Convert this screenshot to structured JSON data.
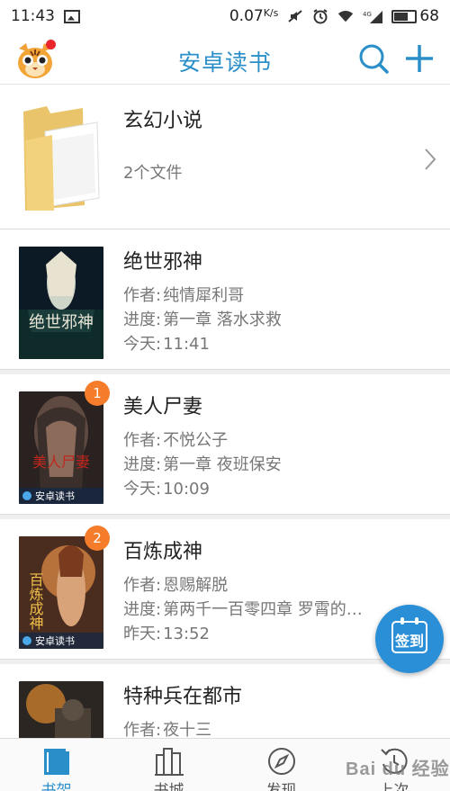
{
  "status_bar": {
    "time": "11:43",
    "speed": "0.07",
    "speed_unit": "K/s",
    "network": "4G",
    "battery": "68",
    "battery_level": 0.68
  },
  "header": {
    "title": "安卓读书",
    "search_icon": "search-icon",
    "add_icon": "plus-icon",
    "accent_color": "#2a8fc9"
  },
  "folder": {
    "title": "玄幻小说",
    "count": "2个文件"
  },
  "books": [
    {
      "title": "绝世邪神",
      "author_label": "作者:",
      "author": "纯情犀利哥",
      "progress_label": "进度:",
      "progress": "第一章 落水求救",
      "time_label": "今天:",
      "time": "11:41",
      "badge": "",
      "cover_text": "绝世邪神",
      "cover_brand": ""
    },
    {
      "title": "美人尸妻",
      "author_label": "作者:",
      "author": "不悦公子",
      "progress_label": "进度:",
      "progress": "第一章 夜班保安",
      "time_label": "今天:",
      "time": "10:09",
      "badge": "1",
      "cover_text": "美人尸妻",
      "cover_brand": "安卓读书"
    },
    {
      "title": "百炼成神",
      "author_label": "作者:",
      "author": "恩赐解脱",
      "progress_label": "进度:",
      "progress": "第两千一百零四章 罗霄的…",
      "time_label": "昨天:",
      "time": "13:52",
      "badge": "2",
      "cover_text": "百炼成神",
      "cover_brand": "安卓读书"
    },
    {
      "title": "特种兵在都市",
      "author_label": "作者:",
      "author": "夜十三",
      "progress_label": "",
      "progress": "",
      "time_label": "",
      "time": "",
      "badge": "",
      "cover_text": "",
      "cover_brand": ""
    }
  ],
  "sign_in": {
    "label": "签到"
  },
  "nav": [
    {
      "label": "书架",
      "icon": "bookshelf-icon",
      "active": true
    },
    {
      "label": "书城",
      "icon": "bookstore-icon",
      "active": false
    },
    {
      "label": "发现",
      "icon": "compass-icon",
      "active": false
    },
    {
      "label": "上次",
      "icon": "history-icon",
      "active": false
    }
  ],
  "watermark": "Bai du 经验"
}
